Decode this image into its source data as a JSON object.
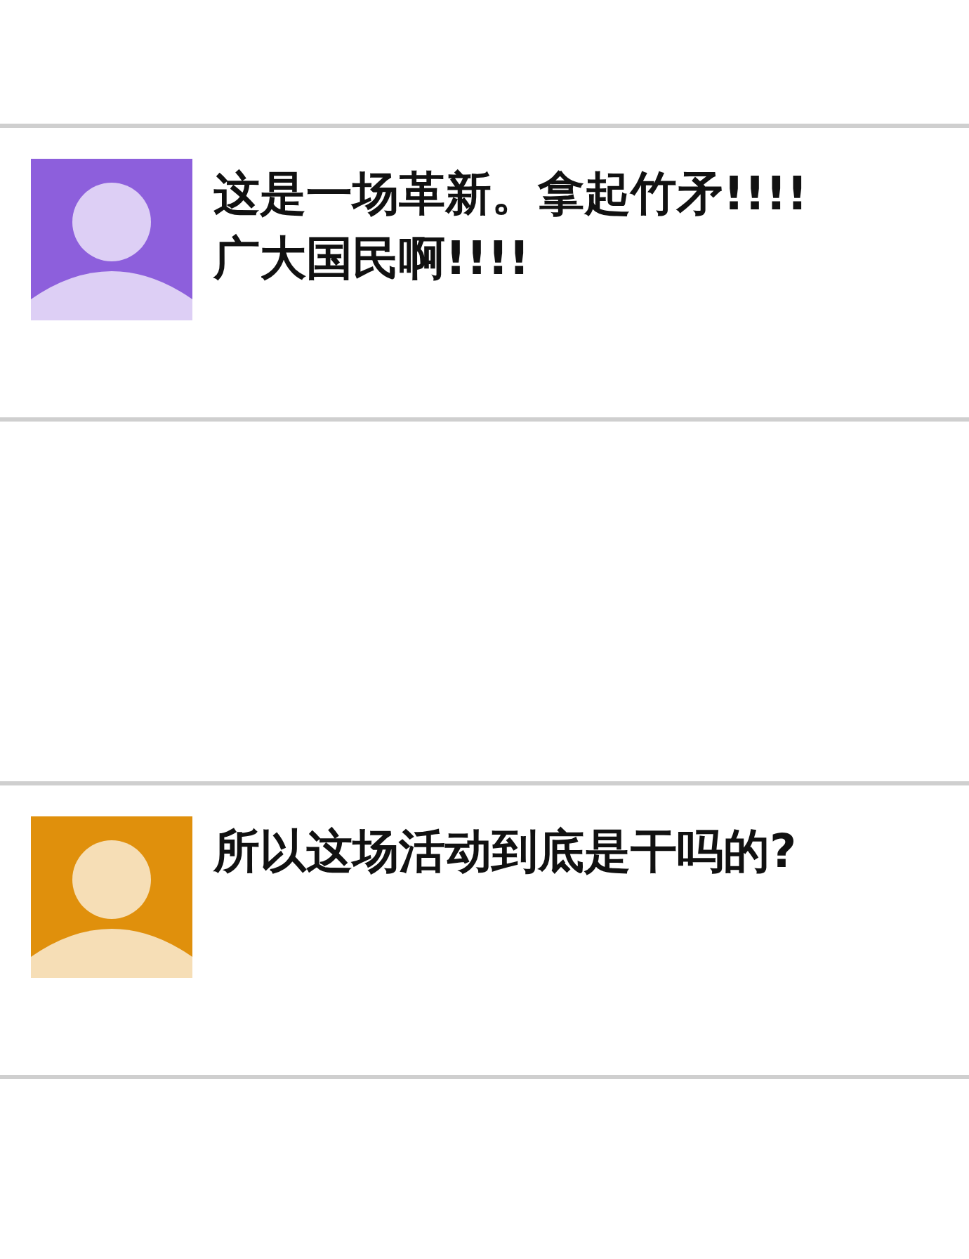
{
  "posts": [
    {
      "kind": "comment",
      "color": "#8d5fdc",
      "text": "这是一场革新。拿起竹矛!!!!广大国民啊!!!!"
    },
    {
      "kind": "empty"
    },
    {
      "kind": "comment",
      "color": "#e0900c",
      "text": "所以这场活动到底是干吗的?"
    }
  ]
}
